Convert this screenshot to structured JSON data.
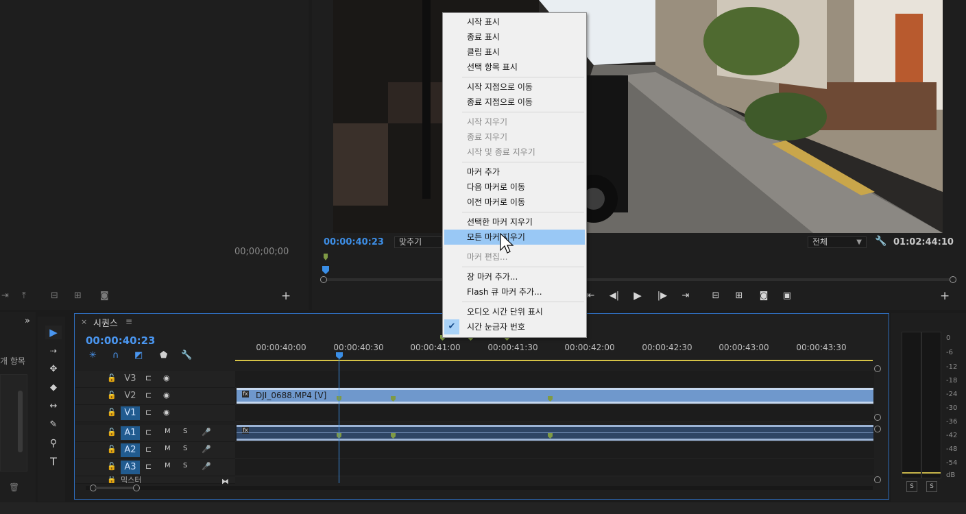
{
  "source_monitor": {
    "timecode": "00;00;00;00",
    "controls": [
      "mark-out-icon",
      "insert-icon",
      "lift-icon",
      "extract-icon",
      "camera-icon"
    ],
    "add_button": "+"
  },
  "program_monitor": {
    "current_timecode": "00:00:40:23",
    "fit_select": "맞추기",
    "resolution_select": "전체",
    "duration": "01:02:44:10",
    "add_button": "+"
  },
  "project_panel": {
    "label": "개 항목"
  },
  "timeline": {
    "tab_label": "시퀀스",
    "tab_menu": "≡",
    "close": "×",
    "timecode": "00:00:40:23",
    "ruler_labels": [
      "00:00:40:00",
      "00:00:40:30",
      "00:00:41:00",
      "00:00:41:30",
      "00:00:42:00",
      "00:00:42:30",
      "00:00:43:00",
      "00:00:43:30"
    ],
    "video_tracks": [
      {
        "name": "V3",
        "active": false
      },
      {
        "name": "V2",
        "active": false
      },
      {
        "name": "V1",
        "active": true
      }
    ],
    "audio_tracks": [
      {
        "name": "A1",
        "active": true,
        "m": "M",
        "s": "S"
      },
      {
        "name": "A2",
        "active": true,
        "m": "M",
        "s": "S"
      },
      {
        "name": "A3",
        "active": true,
        "m": "M",
        "s": "S"
      }
    ],
    "mix_label": "믹스터",
    "video_clip": "DJI_0688.MP4 [V]"
  },
  "meters": {
    "db_scale": [
      "0",
      "-6",
      "-12",
      "-18",
      "-24",
      "-30",
      "-36",
      "-42",
      "-48",
      "-54",
      "dB"
    ],
    "solo_left": "S",
    "solo_right": "S"
  },
  "context_menu": {
    "groups": [
      [
        {
          "label": "시작 표시",
          "enabled": true
        },
        {
          "label": "종료 표시",
          "enabled": true
        },
        {
          "label": "클립 표시",
          "enabled": true
        },
        {
          "label": "선택 항목 표시",
          "enabled": true
        }
      ],
      [
        {
          "label": "시작 지점으로 이동",
          "enabled": true
        },
        {
          "label": "종료 지점으로 이동",
          "enabled": true
        }
      ],
      [
        {
          "label": "시작 지우기",
          "enabled": false
        },
        {
          "label": "종료 지우기",
          "enabled": false
        },
        {
          "label": "시작 및 종료 지우기",
          "enabled": false
        }
      ],
      [
        {
          "label": "마커 추가",
          "enabled": true
        },
        {
          "label": "다음 마커로 이동",
          "enabled": true
        },
        {
          "label": "이전 마커로 이동",
          "enabled": true
        }
      ],
      [
        {
          "label": "선택한 마커 지우기",
          "enabled": true
        },
        {
          "label": "모든 마커 지우기",
          "enabled": true,
          "highlighted": true
        },
        {
          "label": "마커 편집...",
          "enabled": false
        }
      ],
      [
        {
          "label": "장 마커 추가...",
          "enabled": true
        },
        {
          "label": "Flash 큐 마커 추가...",
          "enabled": true
        }
      ],
      [
        {
          "label": "오디오 시간 단위 표시",
          "enabled": true
        },
        {
          "label": "시간 눈금자 번호",
          "enabled": true,
          "checked": true
        }
      ]
    ]
  },
  "colors": {
    "accent": "#3a8ee6",
    "menu_highlight": "#99c8f5",
    "clip_video": "#6f98cc",
    "marker": "#7f9a45",
    "work_area": "#d7c447"
  }
}
